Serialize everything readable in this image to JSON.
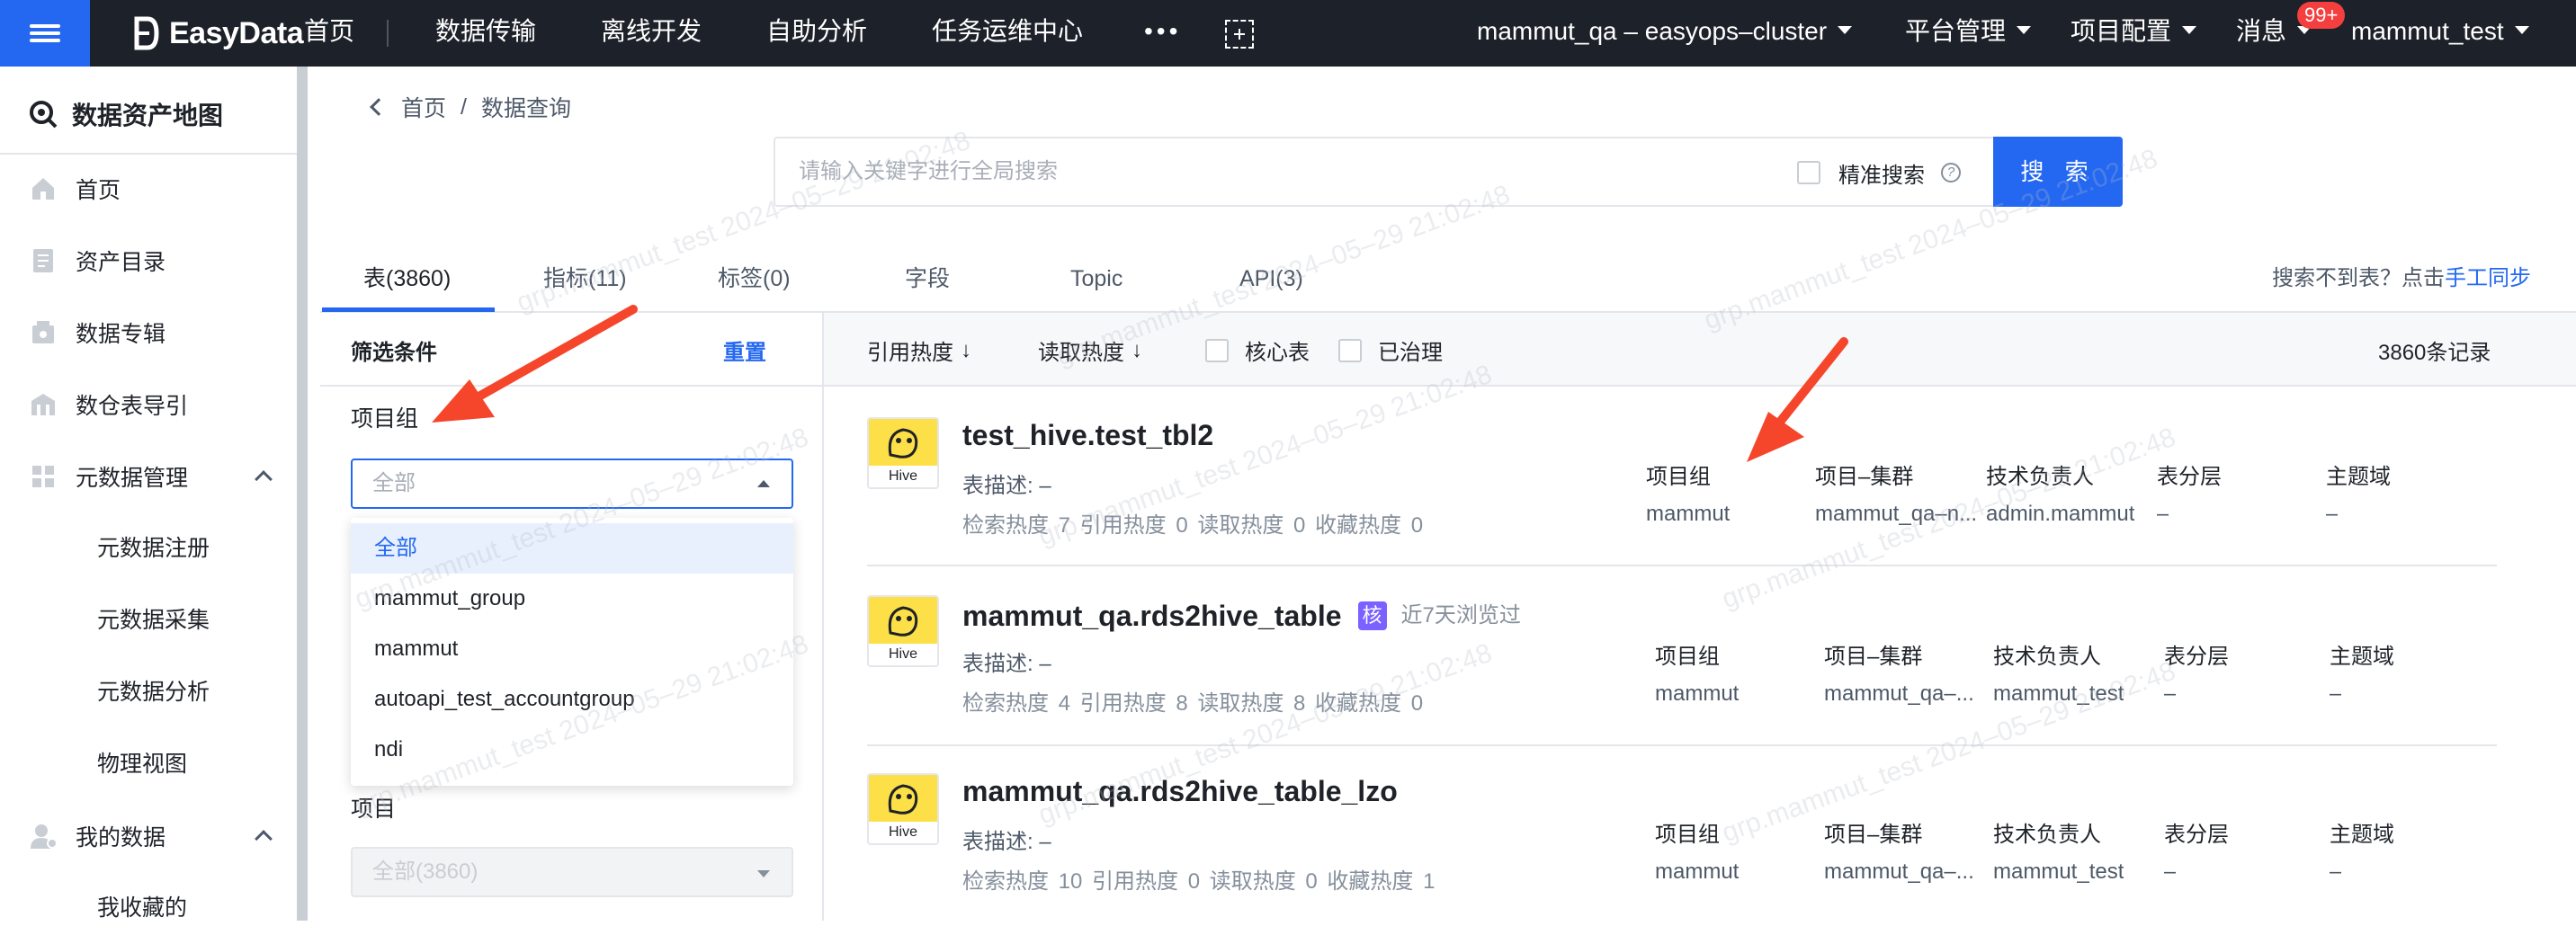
{
  "topbar": {
    "logo": "EasyData",
    "nav": [
      "首页",
      "数据传输",
      "离线开发",
      "自助分析",
      "任务运维中心"
    ],
    "more": "•••",
    "cluster": "mammut_qa – easyops–cluster",
    "platform": "平台管理",
    "project_config": "项目配置",
    "messages": "消息",
    "badge": "99+",
    "user": "mammut_test"
  },
  "sidebar": {
    "title": "数据资产地图",
    "items": [
      {
        "label": "首页",
        "icon": "home-icon"
      },
      {
        "label": "资产目录",
        "icon": "catalog-icon"
      },
      {
        "label": "数据专辑",
        "icon": "album-icon"
      },
      {
        "label": "数仓表导引",
        "icon": "warehouse-icon"
      },
      {
        "label": "元数据管理",
        "icon": "grid-icon"
      }
    ],
    "meta_sub": [
      "元数据注册",
      "元数据采集",
      "元数据分析",
      "物理视图"
    ],
    "my_data": "我的数据",
    "my_sub": [
      "我收藏的"
    ]
  },
  "breadcrumb": {
    "home": "首页",
    "sep": "/",
    "current": "数据查询"
  },
  "search": {
    "placeholder": "请输入关键字进行全局搜索",
    "precise": "精准搜索",
    "button": "搜 索"
  },
  "tabs": [
    "表(3860)",
    "指标(11)",
    "标签(0)",
    "字段",
    "Topic",
    "API(3)"
  ],
  "cant_find": {
    "text": "搜索不到表？点击",
    "link": "手工同步"
  },
  "filter": {
    "title": "筛选条件",
    "reset": "重置",
    "group_label": "项目组",
    "group_value": "全部",
    "options": [
      "全部",
      "mammut_group",
      "mammut",
      "autoapi_test_accountgroup",
      "ndi"
    ],
    "project_label": "项目",
    "project_value": "全部(3860)"
  },
  "toolbar": {
    "ref_heat": "引用热度",
    "read_heat": "读取热度",
    "arrow": "↓",
    "core": "核心表",
    "governed": "已治理",
    "records": "3860条记录"
  },
  "meta_headers": [
    "项目组",
    "项目–集群",
    "技术负责人",
    "表分层",
    "主题域"
  ],
  "results": [
    {
      "name": "test_hive.test_tbl2",
      "desc": "表描述: –",
      "stats": "检索热度 7   引用热度 0   读取热度 0   收藏热度 0",
      "group": "mammut",
      "cluster": "mammut_qa–n...",
      "owner": "admin.mammut",
      "layer": "–",
      "domain": "–"
    },
    {
      "name": "mammut_qa.rds2hive_table",
      "badge": "核",
      "viewed": "近7天浏览过",
      "desc": "表描述: –",
      "stats": "检索热度 4   引用热度 8   读取热度 8   收藏热度 0",
      "group": "mammut",
      "cluster": "mammut_qa–...",
      "owner": "mammut_test",
      "layer": "–",
      "domain": "–"
    },
    {
      "name": "mammut_qa.rds2hive_table_lzo",
      "desc": "表描述: –",
      "stats": "检索热度 10   引用热度 0   读取热度 0   收藏热度 1",
      "group": "mammut",
      "cluster": "mammut_qa–...",
      "owner": "mammut_test",
      "layer": "–",
      "domain": "–"
    }
  ],
  "hive_label": "Hive",
  "watermark": "grp.mammut_test 2024–05–29 21:02:48",
  "colors": {
    "primary": "#2468f2",
    "topbar": "#1d2129",
    "badge": "#f53f3f",
    "core": "#7b61ff",
    "hive": "#fde047"
  }
}
